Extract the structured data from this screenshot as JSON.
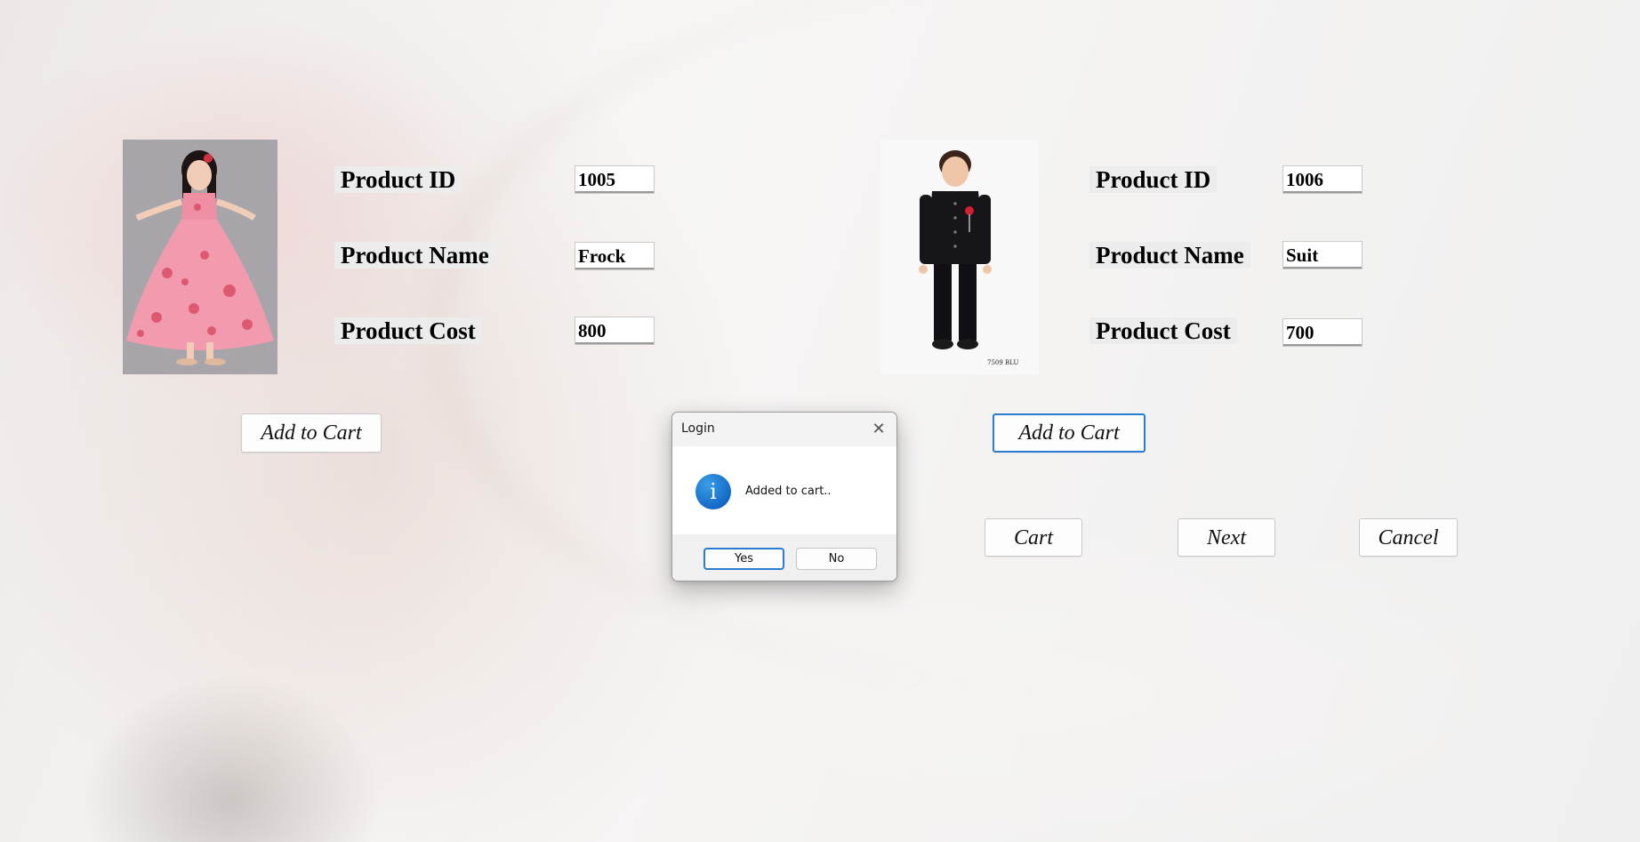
{
  "products": [
    {
      "image_icon": "frock-photo",
      "labels": {
        "id": "Product ID",
        "name": "Product Name",
        "cost": "Product Cost"
      },
      "id": "1005",
      "name": "Frock",
      "cost": "800",
      "add_to_cart": "Add to Cart"
    },
    {
      "image_icon": "suit-photo",
      "image_caption": "7509 BLU",
      "labels": {
        "id": "Product ID",
        "name": "Product Name",
        "cost": "Product Cost"
      },
      "id": "1006",
      "name": "Suit",
      "cost": "700",
      "add_to_cart": "Add to Cart"
    }
  ],
  "actions": {
    "cart": "Cart",
    "next": "Next",
    "cancel": "Cancel"
  },
  "dialog": {
    "title": "Login",
    "close_icon": "close-icon",
    "icon": "info-icon",
    "icon_glyph": "i",
    "message": "Added to cart..",
    "yes": "Yes",
    "no": "No"
  },
  "colors": {
    "focus_accent": "#2b7cd3",
    "info_icon": "#1a78d2",
    "label_bg": "#ececec"
  }
}
